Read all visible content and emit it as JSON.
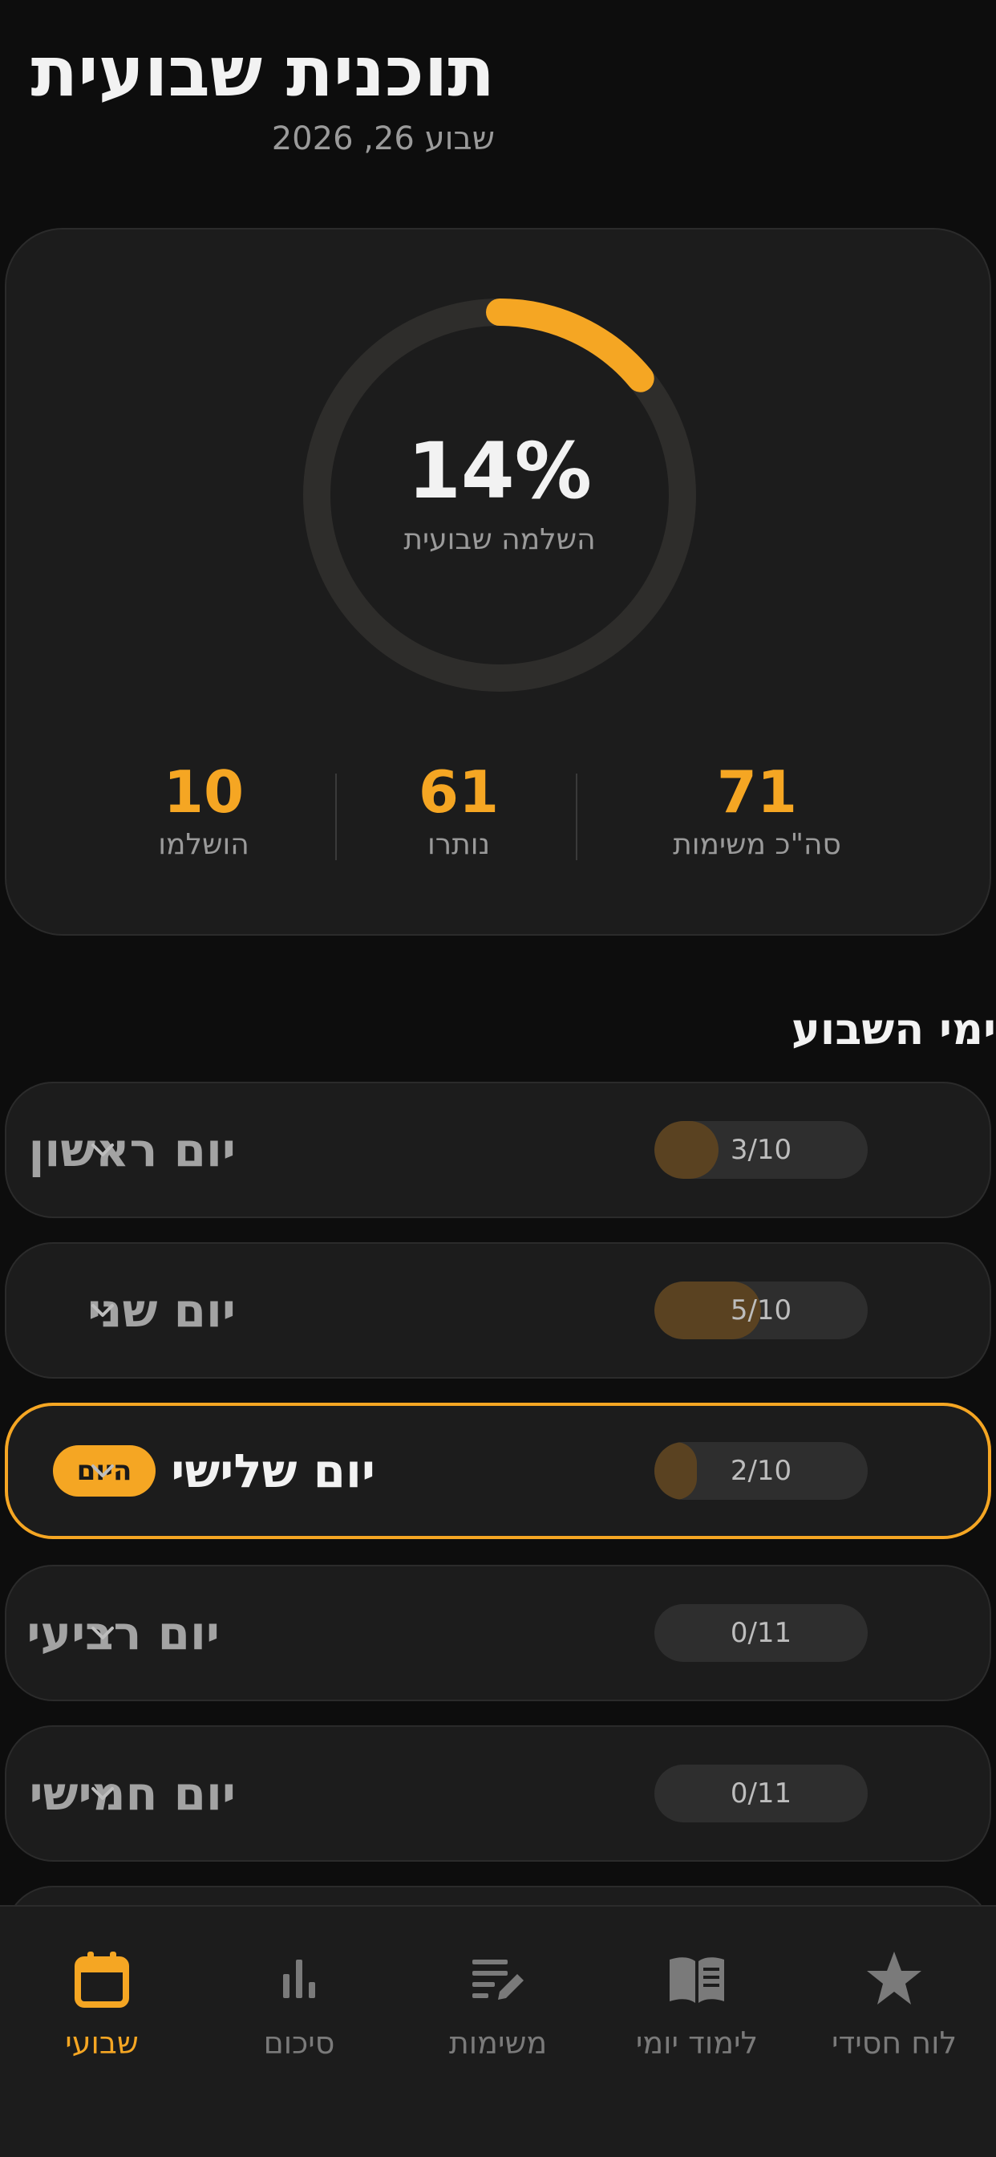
{
  "header": {
    "title": "תוכנית שבועית",
    "subtitle": "שבוע 26, 2026"
  },
  "summary": {
    "completion_percent": 14,
    "completion_percent_label": "14%",
    "completion_label": "השלמה שבועית",
    "stats": [
      {
        "value": "71",
        "label": "סה\"כ משימות"
      },
      {
        "value": "61",
        "label": "נותרו"
      },
      {
        "value": "10",
        "label": "הושלמו"
      }
    ]
  },
  "days_section": {
    "title": "ימי השבוע",
    "days": [
      {
        "name": "יום ראשון",
        "progress_text": "3/10",
        "done": 3,
        "total": 10,
        "today": false
      },
      {
        "name": "יום שני",
        "progress_text": "5/10",
        "done": 5,
        "total": 10,
        "today": false
      },
      {
        "name": "יום שלישי",
        "progress_text": "2/10",
        "done": 2,
        "total": 10,
        "today": true,
        "badge": "היום"
      },
      {
        "name": "יום רביעי",
        "progress_text": "0/11",
        "done": 0,
        "total": 11,
        "today": false
      },
      {
        "name": "יום חמישי",
        "progress_text": "0/11",
        "done": 0,
        "total": 11,
        "today": false
      }
    ]
  },
  "bottom_nav": {
    "items": [
      {
        "label": "לוח חסידי",
        "icon": "star-icon",
        "active": false
      },
      {
        "label": "לימוד יומי",
        "icon": "open-book-icon",
        "active": false
      },
      {
        "label": "משימות",
        "icon": "edit-list-icon",
        "active": false
      },
      {
        "label": "סיכום",
        "icon": "bar-chart-icon",
        "active": false
      },
      {
        "label": "שבועי",
        "icon": "calendar-icon",
        "active": true
      }
    ]
  },
  "colors": {
    "accent": "#f5a623",
    "background": "#0d0d0d",
    "card": "#1c1c1c",
    "muted_text": "#9a9a9a"
  }
}
